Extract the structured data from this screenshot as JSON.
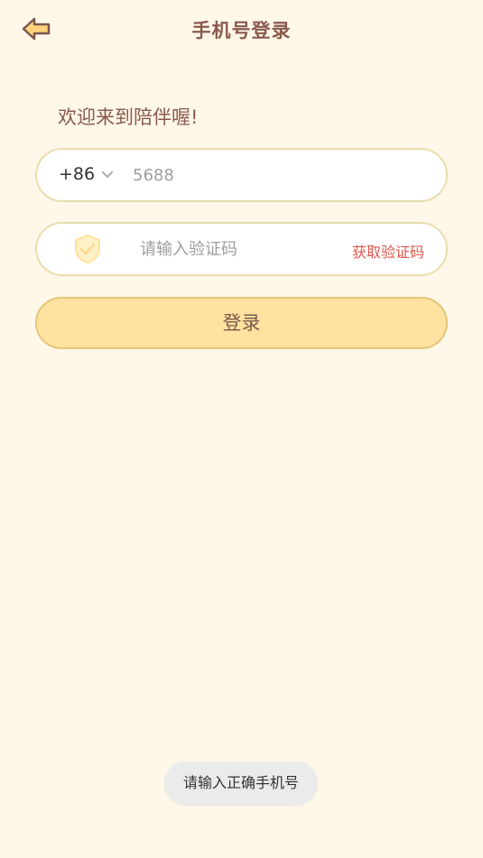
{
  "header": {
    "title": "手机号登录",
    "back_icon": "back-arrow-icon"
  },
  "welcome_text": "欢迎来到陪伴喔!",
  "phone": {
    "country_code": "+86",
    "value": "5688"
  },
  "code": {
    "placeholder": "请输入验证码",
    "get_code_label": "获取验证码",
    "shield_icon": "shield-check-icon"
  },
  "login_button": "登录",
  "toast": "请输入正确手机号",
  "colors": {
    "background": "#fff7e8",
    "title": "#8a5a4e",
    "field_border": "#e9ddb0",
    "accent_button": "#ffe29f",
    "link_red": "#e0554b"
  }
}
